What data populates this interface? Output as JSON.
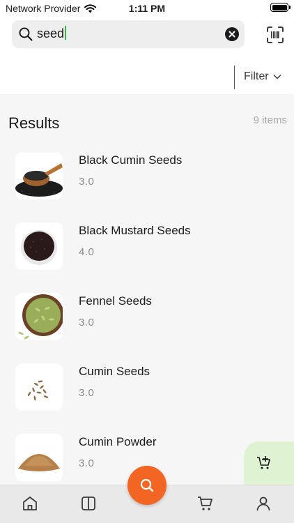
{
  "status_bar": {
    "carrier": "Network Provider",
    "time": "1:11 PM"
  },
  "search": {
    "value": "seed",
    "icons": [
      "search-icon",
      "clear-icon",
      "barcode-scan-icon"
    ]
  },
  "filter": {
    "label": "Filter"
  },
  "results": {
    "title": "Results",
    "count": "9 items",
    "items": [
      {
        "name": "Black Cumin Seeds",
        "rating": "3.0"
      },
      {
        "name": "Black Mustard Seeds",
        "rating": "4.0"
      },
      {
        "name": "Fennel Seeds",
        "rating": "3.0"
      },
      {
        "name": "Cumin Seeds",
        "rating": "3.0"
      },
      {
        "name": "Cumin Powder",
        "rating": "3.0"
      }
    ]
  },
  "tab_bar": {
    "tabs": [
      "home-icon",
      "catalog-icon",
      "search-icon",
      "cart-icon",
      "profile-icon"
    ]
  },
  "colors": {
    "accent": "#f26522",
    "cart_fab": "#dff3d3",
    "caret": "#3bb54a"
  }
}
